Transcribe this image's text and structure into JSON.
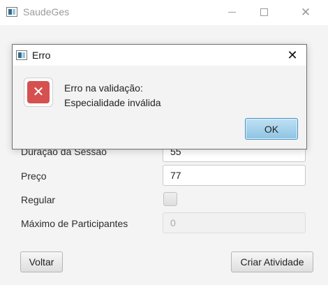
{
  "main_window": {
    "title": "SaudeGes",
    "icon": "app-window-icon",
    "controls": {
      "minimize": "minimize-icon",
      "maximize": "maximize-icon",
      "close": "close-icon"
    }
  },
  "form": {
    "duracao": {
      "label": "Duração da Sessão",
      "value": "55"
    },
    "preco": {
      "label": "Preço",
      "value": "77"
    },
    "regular": {
      "label": "Regular",
      "checked": false
    },
    "maximo": {
      "label": "Máximo de Participantes",
      "value": "0",
      "disabled": true
    },
    "voltar_label": "Voltar",
    "criar_label": "Criar Atividade"
  },
  "dialog": {
    "title": "Erro",
    "message_line1": "Erro na validação:",
    "message_line2": "Especialidade inválida",
    "ok_label": "OK",
    "icon": "error-icon"
  },
  "colors": {
    "error_red": "#d55150",
    "ok_button": "#a9d4ec",
    "ok_border": "#3c8fc6"
  }
}
